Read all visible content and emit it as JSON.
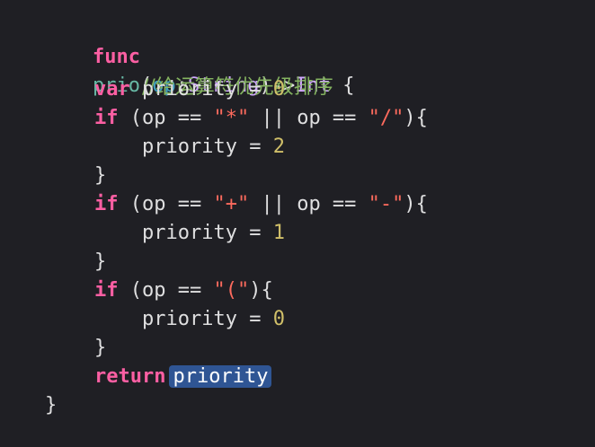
{
  "editor": {
    "line1": {
      "kw_func": "func",
      "fn_name": "prio",
      "open_paren": "(",
      "param_name": "op",
      "colon": ":",
      "param_type": "String",
      "close_arrow": ")->",
      "return_type": "Int",
      "open_brace": " {"
    },
    "line2": {
      "comment": "//给运算符优先级排序"
    },
    "line3": {
      "kw_var": "var",
      "ident": " priority = ",
      "value": "0"
    },
    "line4": {
      "kw_if": "if",
      "cond_a": " (op == ",
      "str_a": "\"*\"",
      "cond_b": " || op == ",
      "str_b": "\"/\"",
      "cond_end": "){"
    },
    "line5": {
      "ident": "priority = ",
      "value": "2"
    },
    "line6": {
      "brace": "}"
    },
    "line7": {
      "kw_if": "if",
      "cond_a": " (op == ",
      "str_a": "\"+\"",
      "cond_b": " || op == ",
      "str_b": "\"-\"",
      "cond_end": "){"
    },
    "line8": {
      "ident": "priority = ",
      "value": "1"
    },
    "line9": {
      "brace": "}"
    },
    "line10": {
      "kw_if": "if",
      "cond_a": " (op == ",
      "str_a": "\"(\"",
      "cond_end": "){"
    },
    "line11": {
      "ident": "priority = ",
      "value": "0"
    },
    "line12": {
      "brace": "}"
    },
    "line13": {
      "kw_return": "return",
      "selected": "priority"
    },
    "line14": {
      "brace": "}"
    }
  },
  "colors": {
    "background": "#1f1f24",
    "keyword": "#fc5fa3",
    "string": "#fc6a5d",
    "number": "#d0bf69",
    "comment": "#84b360",
    "type": "#d0a8ff",
    "selection": "#2f5594"
  }
}
